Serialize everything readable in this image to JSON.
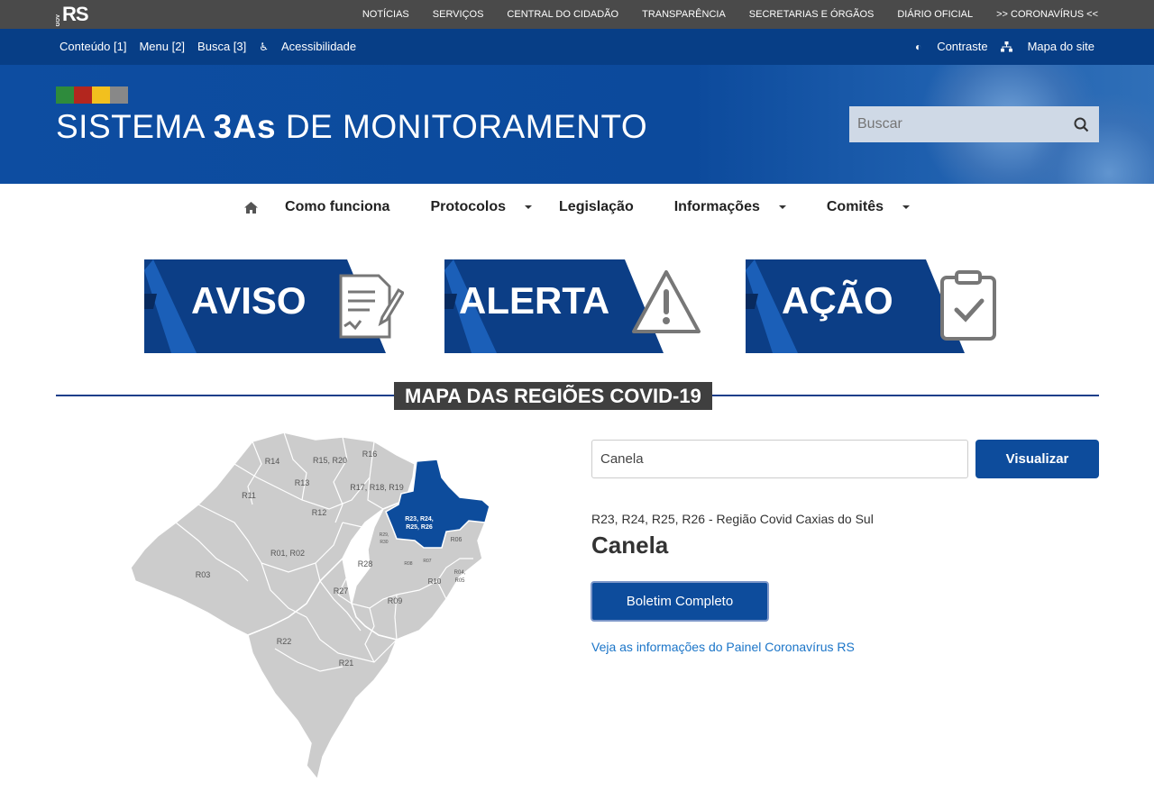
{
  "logo": {
    "small": "GOV",
    "text": "RS"
  },
  "topnav": [
    "NOTÍCIAS",
    "SERVIÇOS",
    "CENTRAL DO CIDADÃO",
    "TRANSPARÊNCIA",
    "SECRETARIAS E ÓRGÃOS",
    "DIÁRIO OFICIAL",
    ">> CORONAVÍRUS <<"
  ],
  "accessibility": {
    "left": [
      "Conteúdo [1]",
      "Menu [2]",
      "Busca [3]",
      "Acessibilidade"
    ],
    "contrast": "Contraste",
    "sitemap": "Mapa do site"
  },
  "hero": {
    "title_pre": "SISTEMA ",
    "title_bold": "3As",
    "title_post": " DE MONITORAMENTO",
    "search_placeholder": "Buscar"
  },
  "mainnav": {
    "home_icon": "home-icon",
    "items": [
      "Como funciona",
      "Protocolos",
      "Legislação",
      "Informações",
      "Comitês"
    ]
  },
  "banners": [
    "AVISO",
    "ALERTA",
    "AÇÃO"
  ],
  "section_title": "MAPA DAS REGIÕES COVID-19",
  "map_labels": {
    "r14": "R14",
    "r15": "R15, R20",
    "r16": "R16",
    "r13": "R13",
    "r11": "R11",
    "r17": "R17, R18, R19",
    "r12": "R12",
    "r23a": "R23, R24,",
    "r23b": "R25, R26",
    "r29a": "R29,",
    "r29b": "R30",
    "r06": "R06",
    "r01": "R01, R02",
    "r03": "R03",
    "r28": "R28",
    "r08": "R08",
    "r07": "R07",
    "r04a": "R04,",
    "r04b": "R05",
    "r10": "R10",
    "r27": "R27",
    "r09": "R09",
    "r22": "R22",
    "r21": "R21"
  },
  "search_city": {
    "value": "Canela",
    "button": "Visualizar"
  },
  "result": {
    "region": "R23, R24, R25, R26 - Região Covid Caxias do Sul",
    "city": "Canela",
    "button": "Boletim Completo",
    "painel_link": "Veja as informações do Painel Coronavírus RS"
  },
  "colors": {
    "primary": "#0d4c9c",
    "navy": "#073e86",
    "topbar": "#4a4a4a",
    "map_region": "#cccccc",
    "map_selected": "#0d4c9c"
  }
}
